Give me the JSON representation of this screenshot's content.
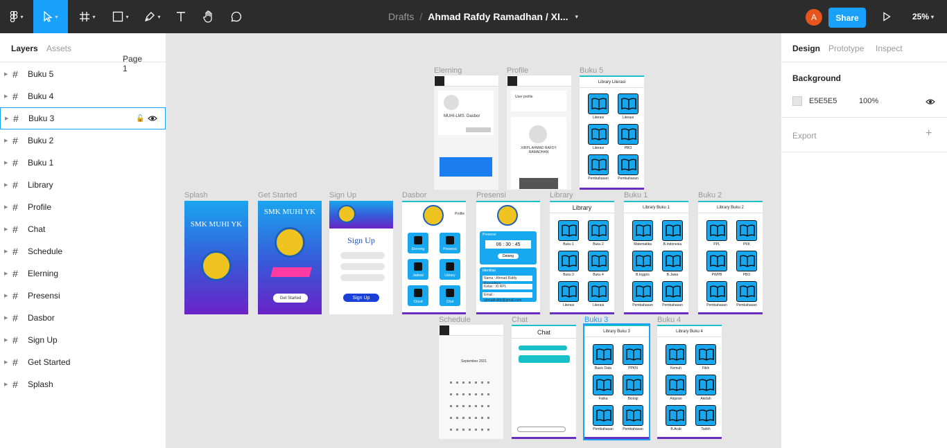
{
  "toolbar": {
    "title_drafts": "Drafts",
    "title_sep": "/",
    "title_file": "Ahmad Rafdy Ramadhan / XI...",
    "avatar_letter": "A",
    "share_label": "Share",
    "zoom": "25%"
  },
  "left_panel": {
    "tab_layers": "Layers",
    "tab_assets": "Assets",
    "page": "Page 1",
    "layers": [
      "Buku 5",
      "Buku 4",
      "Buku 3",
      "Buku 2",
      "Buku 1",
      "Library",
      "Profile",
      "Chat",
      "Schedule",
      "Elerning",
      "Presensi",
      "Dasbor",
      "Sign Up",
      "Get Started",
      "Splash"
    ]
  },
  "right_panel": {
    "tab_design": "Design",
    "tab_prototype": "Prototype",
    "tab_inspect": "Inspect",
    "background_label": "Background",
    "background_hex": "E5E5E5",
    "background_opacity": "100%",
    "export_label": "Export"
  },
  "canvas": {
    "frames": {
      "elerning": "Elerning",
      "profile": "Profile",
      "buku5": "Buku 5",
      "splash": "Splash",
      "get_started": "Get Started",
      "sign_up": "Sign Up",
      "dasbor": "Dasbor",
      "presensi": "Presensi",
      "library": "Library",
      "buku1": "Buku 1",
      "buku2": "Buku 2",
      "schedule": "Schedule",
      "chat": "Chat",
      "buku3": "Buku 3",
      "buku4": "Buku 4"
    },
    "splash_title": "SMK MUHI YK",
    "get_started_title": "SMK MUHI YK",
    "get_started_btn": "Get Started",
    "signup_title": "Sign Up",
    "signup_btn": "Sign Up",
    "library_title": "Library",
    "buku1_title": "Library Buku 1",
    "buku2_title": "Library Buku 2",
    "buku3_title": "Library Buku 3",
    "buku4_title": "Library Buku 4",
    "buku5_title": "Library Literasi",
    "chat_title": "Chat",
    "presensi_time": "06 : 30 : 45",
    "presensi_btn": "Datang",
    "presensi_label": "Presensi",
    "identitas_label": "Identitas",
    "identitas_rows": [
      "Nama : Ahmad Rafdy Ramadhan",
      "Kelas : XI RPL",
      "Email : ahmadrafdy@gmail.com"
    ],
    "elerning_title": "MUHI-LMS: Dasbor",
    "profile_title": "User profile",
    "profile_name": "XIRPL AHMAD RAFDY RAMADHAN",
    "dasbor_items": [
      "Elerning",
      "Presensi",
      "Jadwal",
      "Library",
      "Cloud",
      "Chat"
    ],
    "dasbor_profile": "Profile",
    "library_books": [
      "Buku 1",
      "Buku 2",
      "Buku 3",
      "Buku 4",
      "Literasi",
      "Literasi"
    ],
    "buku1_books": [
      "Matematika",
      "B.Indonesia",
      "B.Inggris",
      "B.Jawa",
      "Pembahasan",
      "Pembahasan"
    ],
    "buku2_books": [
      "PPL",
      "PKK",
      "PWPB",
      "PBO",
      "Pembahasan",
      "Pembahasan"
    ],
    "buku3_books": [
      "Basic Data",
      "PPKN",
      "Fisika",
      "Biologi",
      "Pembahasan",
      "Pembahasan"
    ],
    "buku4_books": [
      "Kemuh",
      "Fikih",
      "Alquran",
      "Akidah",
      "B.Arab",
      "Tarikh"
    ],
    "buku5_books": [
      "Literasi",
      "Literasi",
      "Literasi",
      "PBO",
      "Pembahasan",
      "Pembahasan"
    ],
    "schedule_month": "September 2021"
  }
}
